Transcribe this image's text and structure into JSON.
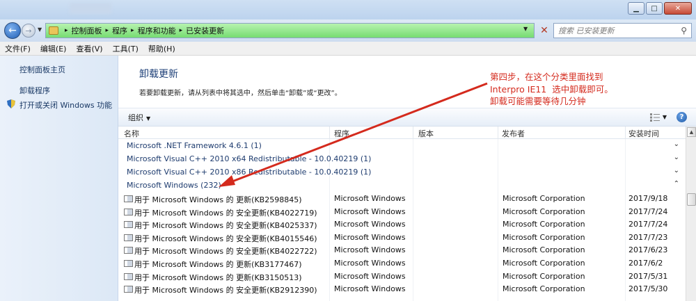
{
  "window": {
    "minimize_label": "▁",
    "maximize_label": "□",
    "close_label": "✕"
  },
  "address_bar": {
    "breadcrumbs": [
      "控制面板",
      "程序",
      "程序和功能",
      "已安装更新"
    ],
    "search_placeholder": "搜索 已安装更新"
  },
  "menu": [
    "文件(F)",
    "编辑(E)",
    "查看(V)",
    "工具(T)",
    "帮助(H)"
  ],
  "sidebar": {
    "items": [
      {
        "label": "控制面板主页"
      },
      {
        "label": "卸载程序"
      },
      {
        "label": "打开或关闭 Windows 功能"
      }
    ]
  },
  "main": {
    "title": "卸载更新",
    "description": "若要卸载更新，请从列表中将其选中，然后单击“卸载”或“更改”。",
    "organize_label": "组织"
  },
  "annotation": {
    "text": "第四步，在这个分类里面找到\nInterpro IE11  选中卸载即可。\n卸载可能需要等待几分钟",
    "color": "#d42a1d"
  },
  "columns": [
    "名称",
    "程序",
    "版本",
    "发布者",
    "安装时间"
  ],
  "groups": [
    {
      "label": "Microsoft .NET Framework 4.6.1 (1)",
      "state": "collapsed"
    },
    {
      "label": "Microsoft Visual C++ 2010  x64 Redistributable - 10.0.40219 (1)",
      "state": "collapsed"
    },
    {
      "label": "Microsoft Visual C++ 2010  x86 Redistributable - 10.0.40219 (1)",
      "state": "collapsed"
    },
    {
      "label": "Microsoft Windows (232)",
      "state": "expanded"
    }
  ],
  "updates": [
    {
      "name": "用于 Microsoft Windows 的 更新(KB2598845)",
      "program": "Microsoft Windows",
      "publisher": "Microsoft Corporation",
      "date": "2017/9/18"
    },
    {
      "name": "用于 Microsoft Windows 的 安全更新(KB4022719)",
      "program": "Microsoft Windows",
      "publisher": "Microsoft Corporation",
      "date": "2017/7/24"
    },
    {
      "name": "用于 Microsoft Windows 的 安全更新(KB4025337)",
      "program": "Microsoft Windows",
      "publisher": "Microsoft Corporation",
      "date": "2017/7/24"
    },
    {
      "name": "用于 Microsoft Windows 的 安全更新(KB4015546)",
      "program": "Microsoft Windows",
      "publisher": "Microsoft Corporation",
      "date": "2017/7/23"
    },
    {
      "name": "用于 Microsoft Windows 的 安全更新(KB4022722)",
      "program": "Microsoft Windows",
      "publisher": "Microsoft Corporation",
      "date": "2017/6/23"
    },
    {
      "name": "用于 Microsoft Windows 的 更新(KB3177467)",
      "program": "Microsoft Windows",
      "publisher": "Microsoft Corporation",
      "date": "2017/6/2"
    },
    {
      "name": "用于 Microsoft Windows 的 更新(KB3150513)",
      "program": "Microsoft Windows",
      "publisher": "Microsoft Corporation",
      "date": "2017/5/31"
    },
    {
      "name": "用于 Microsoft Windows 的 安全更新(KB2912390)",
      "program": "Microsoft Windows",
      "publisher": "Microsoft Corporation",
      "date": "2017/5/30"
    }
  ]
}
